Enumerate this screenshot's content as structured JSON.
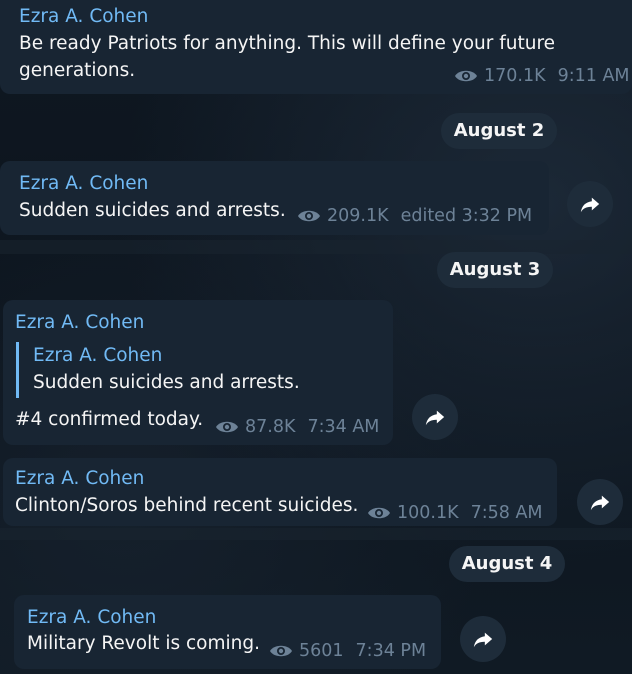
{
  "messages": [
    {
      "sender": "Ezra A. Cohen",
      "text_lines": [
        "Be ready Patriots for anything. This will define your future",
        "generations."
      ],
      "views": "170.1K",
      "time": "9:11 AM"
    },
    {
      "sender": "Ezra A. Cohen",
      "text": "Sudden suicides and arrests.",
      "views": "209.1K",
      "time": "edited 3:32 PM"
    },
    {
      "sender": "Ezra A. Cohen",
      "quote_sender": "Ezra A. Cohen",
      "quote_text": "Sudden suicides and arrests.",
      "text": "#4 confirmed today.",
      "views": "87.8K",
      "time": "7:34 AM"
    },
    {
      "sender": "Ezra A. Cohen",
      "text": "Clinton/Soros behind recent suicides.",
      "views": "100.1K",
      "time": "7:58 AM"
    },
    {
      "sender": "Ezra A. Cohen",
      "text": "Military Revolt is coming.",
      "views": "5601",
      "time": "7:34 PM"
    }
  ],
  "dates": [
    "August 2",
    "August 3",
    "August 4"
  ],
  "icons": {
    "views": "eye-icon",
    "forward": "share-arrow-icon"
  },
  "colors": {
    "background": "#0e1621",
    "bubble": "#182533",
    "sender": "#71baf5",
    "meta": "#6d8297",
    "pill": "#1e2c3a"
  }
}
